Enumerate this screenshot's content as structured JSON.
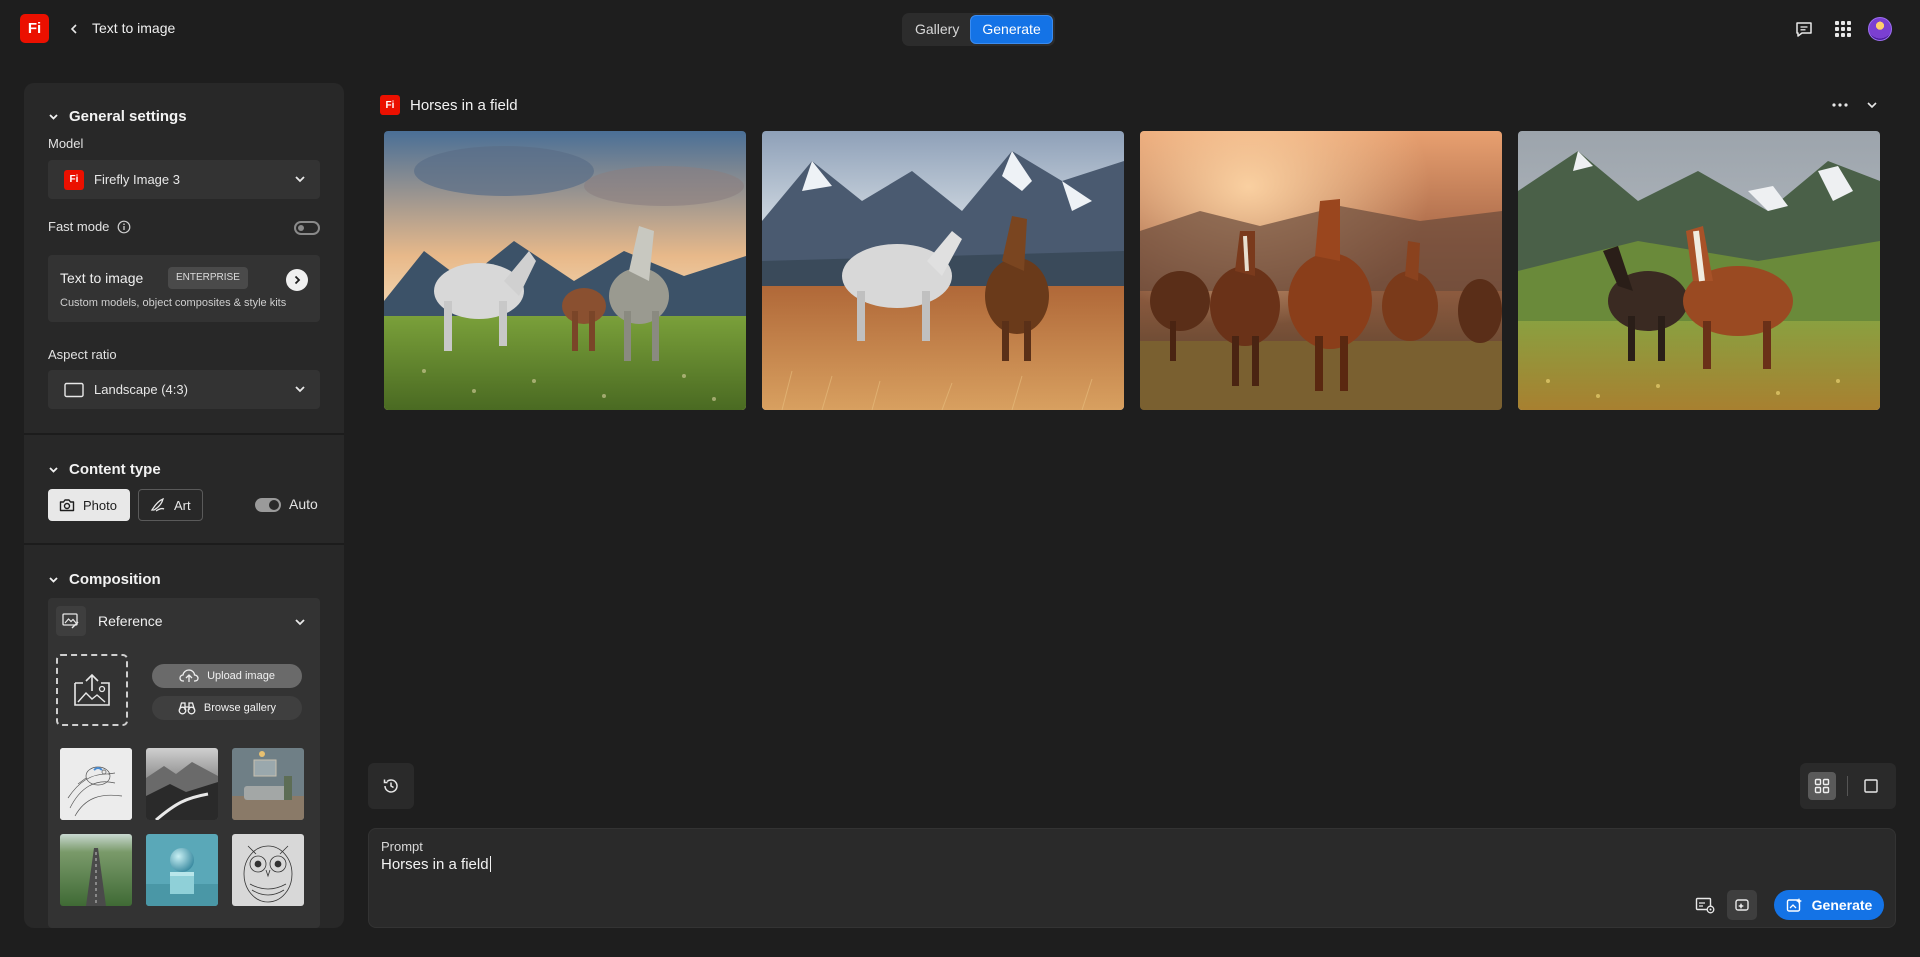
{
  "header": {
    "logo_text": "Fi",
    "app_title": "Text to image",
    "tabs": [
      {
        "label": "Gallery",
        "active": false
      },
      {
        "label": "Generate",
        "active": true
      }
    ],
    "icons": [
      "feedback-icon",
      "apps-grid-icon",
      "avatar"
    ]
  },
  "sidebar": {
    "general_settings": {
      "title": "General settings",
      "model_label": "Model",
      "model_badge": "Fi",
      "model_value": "Firefly Image 3",
      "fast_mode_label": "Fast mode",
      "fast_mode_on": false,
      "enterprise_card": {
        "title": "Text to image",
        "badge": "ENTERPRISE",
        "description": "Custom models, object composites & style kits"
      },
      "aspect_ratio_label": "Aspect ratio",
      "aspect_ratio_value": "Landscape (4:3)"
    },
    "content_type": {
      "title": "Content type",
      "options": [
        {
          "label": "Photo",
          "selected": true
        },
        {
          "label": "Art",
          "selected": false
        }
      ],
      "auto_label": "Auto",
      "auto_on": true
    },
    "composition": {
      "title": "Composition",
      "reference_label": "Reference",
      "upload_label": "Upload image",
      "browse_label": "Browse gallery",
      "thumbnails": [
        "sketch-bird",
        "monochrome-landscape",
        "living-room",
        "road-aerial",
        "sphere-on-cube",
        "sketch-owl"
      ]
    }
  },
  "main": {
    "group_logo": "Fi",
    "group_title": "Horses in a field",
    "images": [
      "horses-mountains-sunset",
      "horses-snowy-peaks",
      "horses-golden-hour-herd",
      "horses-green-valley"
    ],
    "view_mode": "grid"
  },
  "prompt": {
    "label": "Prompt",
    "text": "Horses in a field",
    "generate_label": "Generate"
  },
  "colors": {
    "accent": "#1473e6",
    "brand": "#eb1000",
    "background": "#1e1e1e",
    "panel": "#282828"
  }
}
